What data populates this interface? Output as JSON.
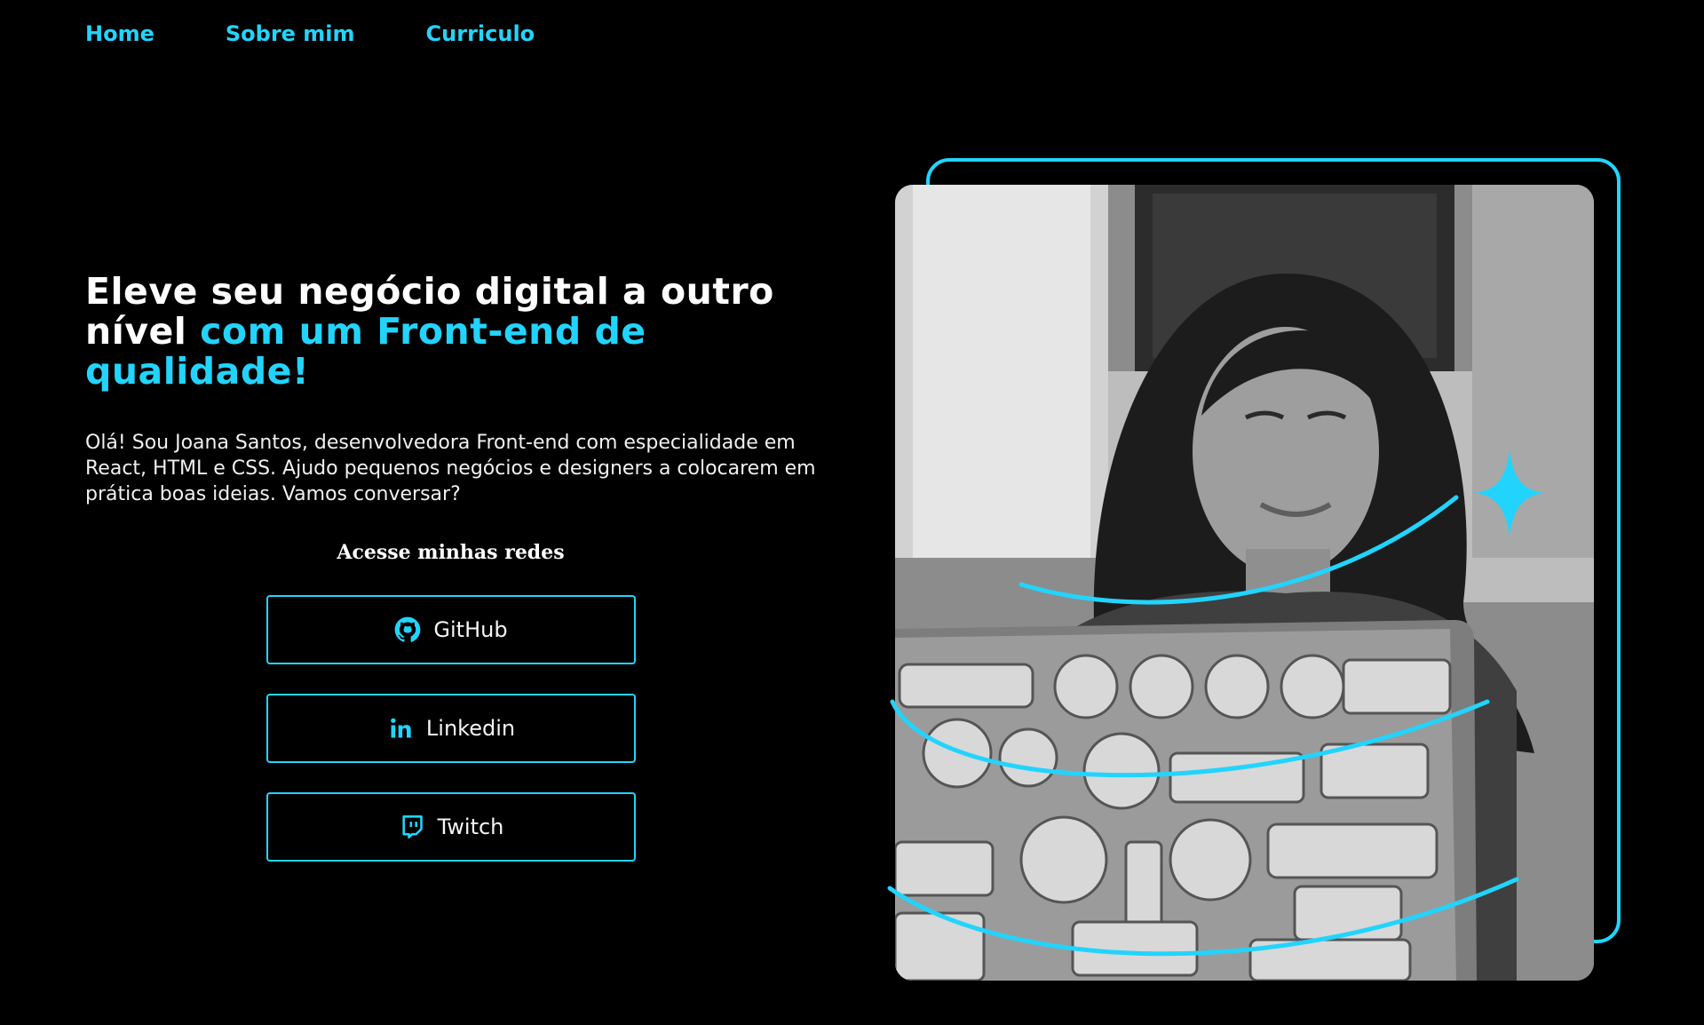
{
  "nav": {
    "items": [
      {
        "label": "Home"
      },
      {
        "label": "Sobre mim"
      },
      {
        "label": "Curriculo"
      }
    ]
  },
  "hero": {
    "headline_white": "Eleve seu negócio digital a outro nível ",
    "headline_accent": "com um Front-end de qualidade!",
    "intro": "Olá! Sou Joana Santos, desenvolvedora Front-end com especialidade em React, HTML e CSS. Ajudo pequenos negócios e designers a colocarem em prática boas ideias. Vamos conversar?"
  },
  "social": {
    "title": "Acesse minhas redes",
    "buttons": [
      {
        "label": "GitHub",
        "icon": "github-icon"
      },
      {
        "label": "Linkedin",
        "icon": "linkedin-icon"
      },
      {
        "label": "Twitch",
        "icon": "twitch-icon"
      }
    ]
  },
  "colors": {
    "accent": "#22d4fd",
    "background": "#000000",
    "text": "#ffffff"
  }
}
